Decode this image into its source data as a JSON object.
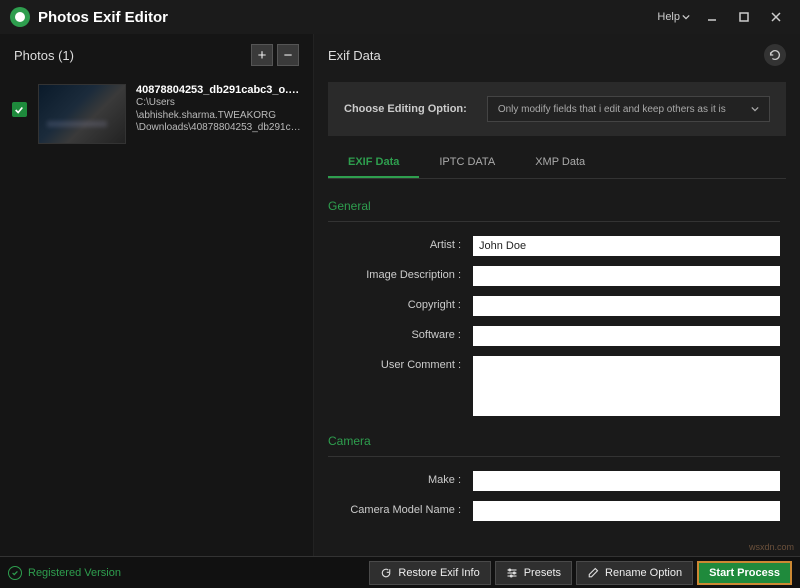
{
  "app": {
    "title": "Photos Exif Editor",
    "help": "Help"
  },
  "sidebar": {
    "header": "Photos (1)",
    "items": [
      {
        "filename": "40878804253_db291cabc3_o.png",
        "path_line1": "C:\\Users",
        "path_line2": "\\abhishek.sharma.TWEAKORG",
        "path_line3": "\\Downloads\\40878804253_db291ca...",
        "checked": true
      }
    ]
  },
  "main": {
    "title": "Exif Data",
    "editing_option_label": "Choose Editing Option:",
    "editing_option_value": "Only modify fields that i edit and keep others as it is",
    "tabs": [
      {
        "label": "EXIF Data",
        "active": true
      },
      {
        "label": "IPTC DATA",
        "active": false
      },
      {
        "label": "XMP Data",
        "active": false
      }
    ],
    "groups": {
      "general": {
        "title": "General",
        "fields": {
          "artist": {
            "label": "Artist :",
            "value": "John Doe"
          },
          "description": {
            "label": "Image Description :",
            "value": ""
          },
          "copyright": {
            "label": "Copyright :",
            "value": ""
          },
          "software": {
            "label": "Software :",
            "value": ""
          },
          "user_comment": {
            "label": "User Comment :",
            "value": ""
          }
        }
      },
      "camera": {
        "title": "Camera",
        "fields": {
          "make": {
            "label": "Make :",
            "value": ""
          },
          "model": {
            "label": "Camera Model Name :",
            "value": ""
          }
        }
      }
    }
  },
  "footer": {
    "status": "Registered Version",
    "buttons": {
      "restore": "Restore Exif Info",
      "presets": "Presets",
      "rename": "Rename Option",
      "start": "Start Process"
    }
  },
  "watermark": "wsxdn.com"
}
